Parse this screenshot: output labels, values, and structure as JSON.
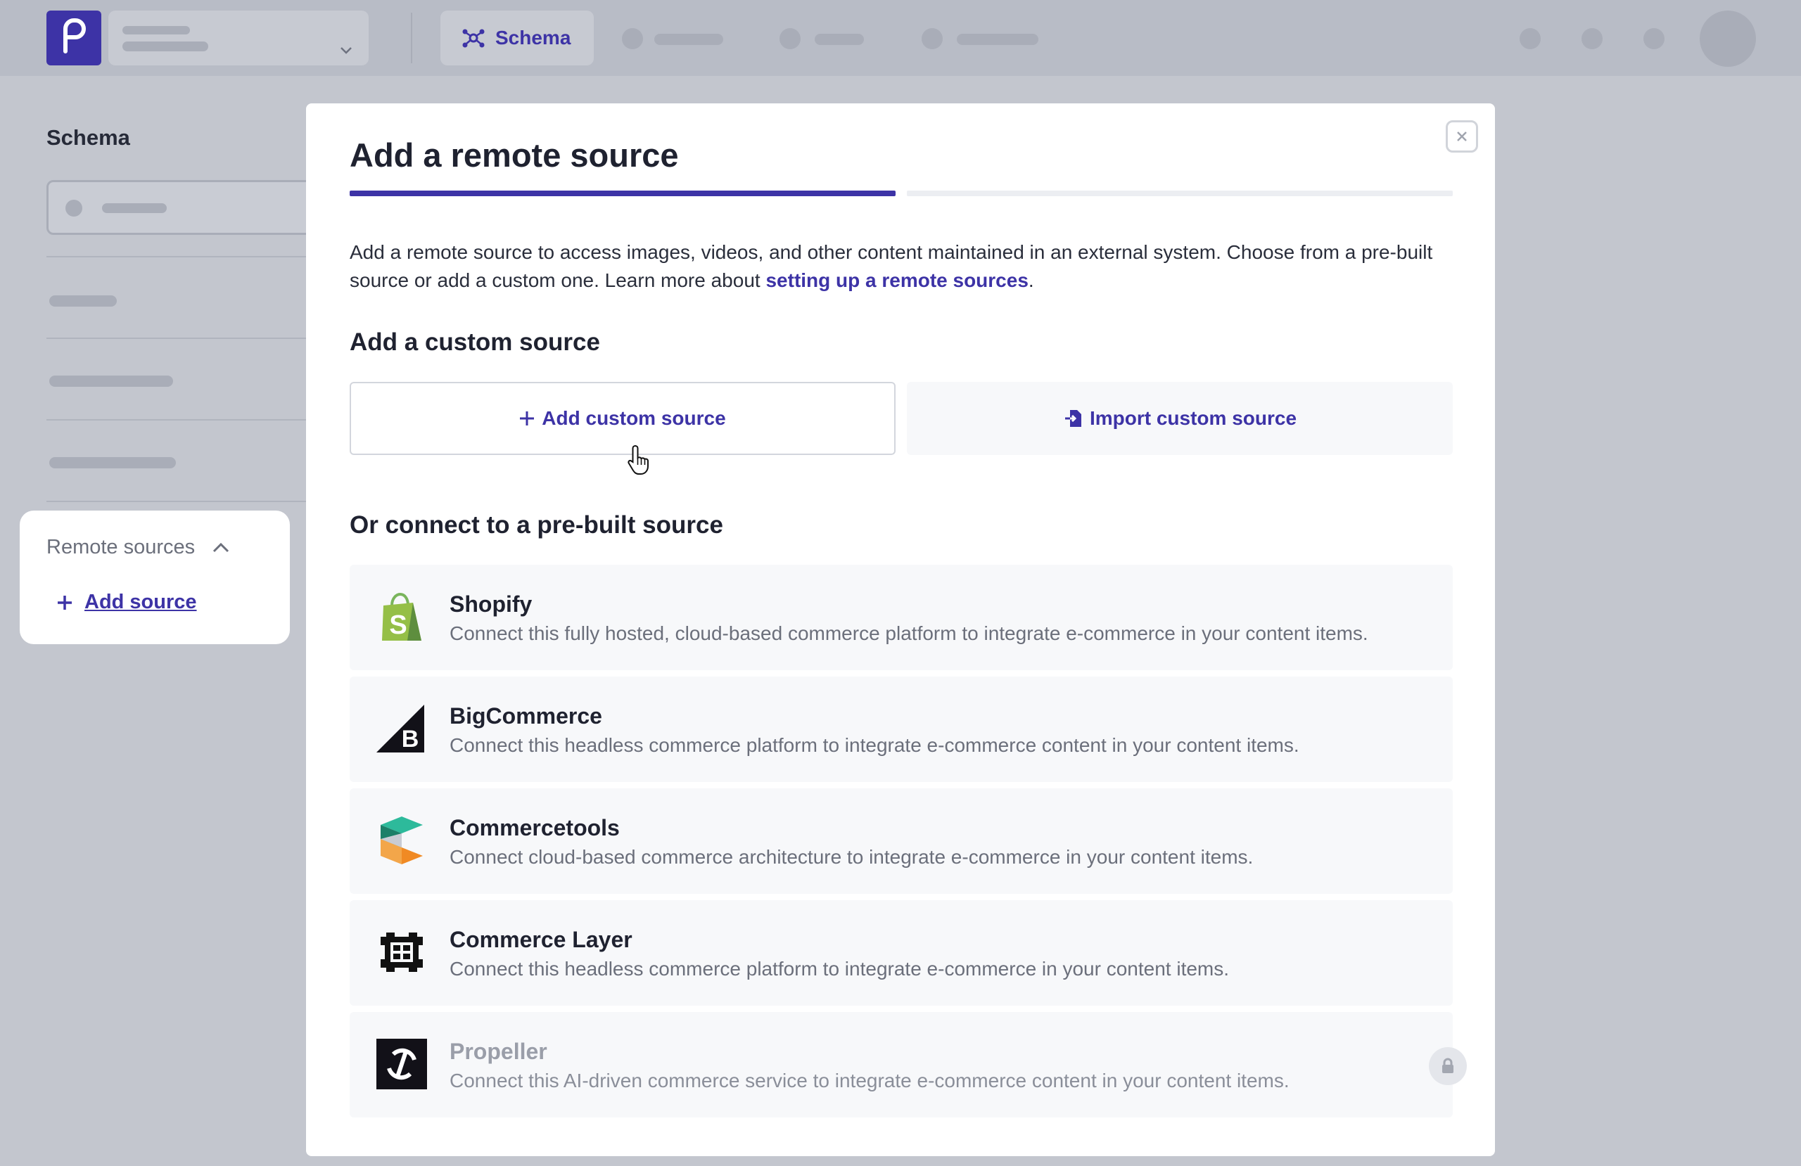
{
  "topbar": {
    "nav_active_label": "Schema"
  },
  "sidebar": {
    "title": "Schema",
    "remote_sources": {
      "title": "Remote sources",
      "add_label": "Add source"
    }
  },
  "modal": {
    "title": "Add a remote source",
    "step_progress": 0.5,
    "intro_text": "Add a remote source to access images, videos, and other content maintained in an external system. Choose from a pre-built source or add a custom one. Learn more about ",
    "intro_link": "setting up a remote sources",
    "intro_end": ".",
    "custom_section_title": "Add a custom source",
    "add_custom_label": "Add custom source",
    "import_custom_label": "Import custom source",
    "prebuilt_section_title": "Or connect to a pre-built source",
    "sources": [
      {
        "name": "Shopify",
        "icon": "shopify-icon",
        "description": "Connect this fully hosted, cloud-based commerce platform to integrate e-commerce in your content items.",
        "locked": false
      },
      {
        "name": "BigCommerce",
        "icon": "bigcommerce-icon",
        "description": "Connect this headless commerce platform to integrate e-commerce content in your content items.",
        "locked": false
      },
      {
        "name": "Commercetools",
        "icon": "commercetools-icon",
        "description": "Connect cloud-based commerce architecture to integrate e-commerce in your content items.",
        "locked": false
      },
      {
        "name": "Commerce Layer",
        "icon": "commerce-layer-icon",
        "description": "Connect this headless commerce platform to integrate e-commerce in your content items.",
        "locked": false
      },
      {
        "name": "Propeller",
        "icon": "propeller-icon",
        "description": "Connect this AI-driven commerce service to integrate e-commerce content in your content items.",
        "locked": true
      }
    ]
  },
  "colors": {
    "accent": "#3d33a6",
    "backdrop": "#c3c6ce",
    "card_bg": "#f7f8fa",
    "muted_text": "#6b6f7b"
  }
}
